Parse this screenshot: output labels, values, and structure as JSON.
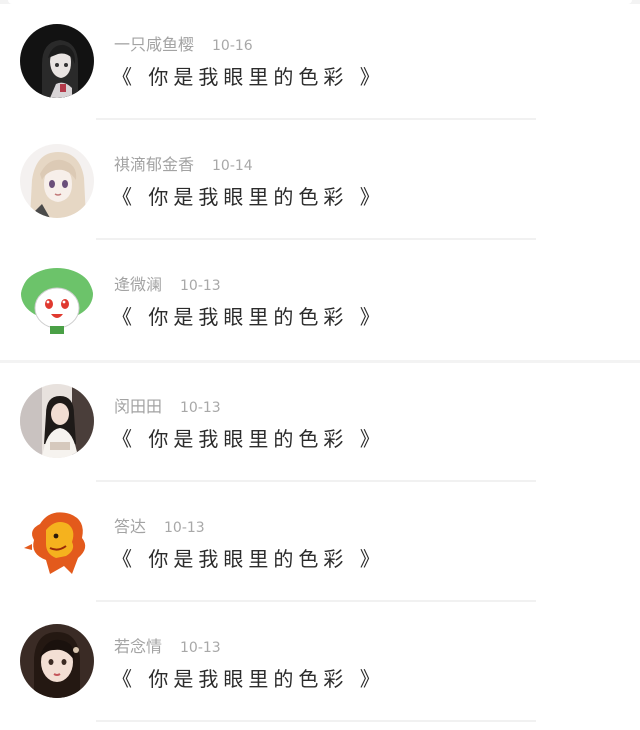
{
  "comments": [
    {
      "username": "一只咸鱼樱",
      "date": "10-16",
      "text": "《 你是我眼里的色彩 》",
      "avatar_icon": "anime-girl-dark-hair-avatar"
    },
    {
      "username": "祺滴郁金香",
      "date": "10-14",
      "text": "《 你是我眼里的色彩 》",
      "avatar_icon": "anime-girl-blonde-avatar"
    },
    {
      "username": "逄微澜",
      "date": "10-13",
      "text": "《 你是我眼里的色彩 》",
      "avatar_icon": "green-cartoon-character-avatar"
    },
    {
      "username": "闵田田",
      "date": "10-13",
      "text": "《 你是我眼里的色彩 》",
      "avatar_icon": "woman-photo-avatar"
    },
    {
      "username": "答达",
      "date": "10-13",
      "text": "《 你是我眼里的色彩 》",
      "avatar_icon": "fire-lion-avatar"
    },
    {
      "username": "若念情",
      "date": "10-13",
      "text": "《 你是我眼里的色彩 》",
      "avatar_icon": "illustrated-woman-avatar"
    }
  ]
}
